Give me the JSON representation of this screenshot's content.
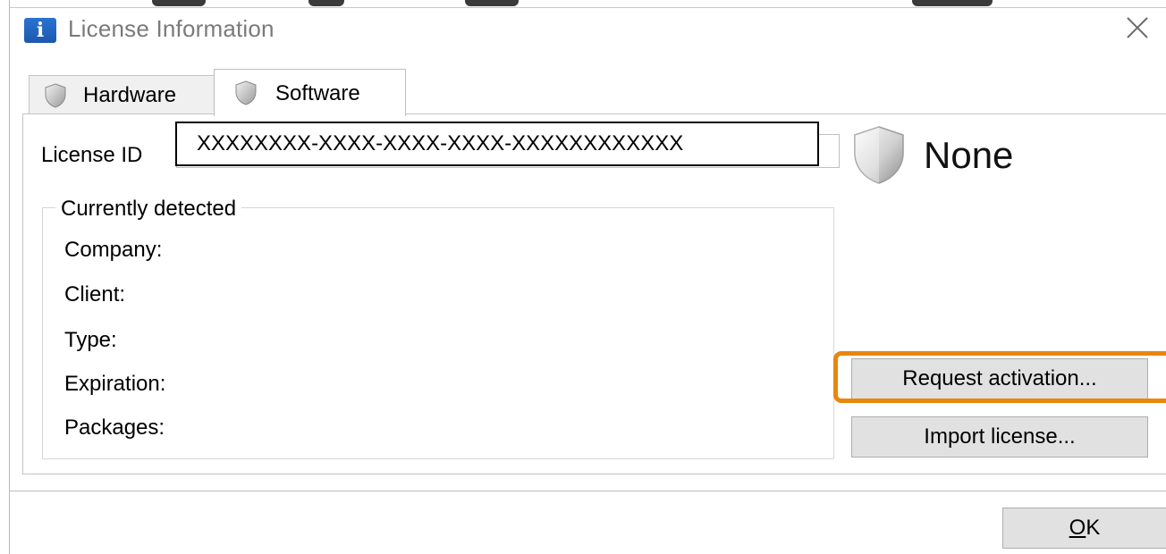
{
  "window": {
    "title": "License Information",
    "icon": "info-icon",
    "close_icon": "close-icon"
  },
  "tabs": [
    {
      "label": "Hardware",
      "icon": "shield-icon",
      "selected": false
    },
    {
      "label": "Software",
      "icon": "shield-icon",
      "selected": true
    }
  ],
  "license": {
    "label": "License ID",
    "value": "XXXXXXXX-XXXX-XXXX-XXXX-XXXXXXXXXXXX"
  },
  "status": {
    "icon": "shield-icon",
    "text": "None"
  },
  "detected": {
    "title": "Currently detected",
    "fields": {
      "company": "Company:",
      "client": "Client:",
      "type": "Type:",
      "expiration": "Expiration:",
      "packages": "Packages:"
    }
  },
  "buttons": {
    "request_activation": "Request activation...",
    "import_license": "Import license...",
    "ok_mnemonic": "O",
    "ok_rest": "K"
  },
  "colors": {
    "highlight": "#e8870c",
    "app_icon": "#2a74d2"
  }
}
